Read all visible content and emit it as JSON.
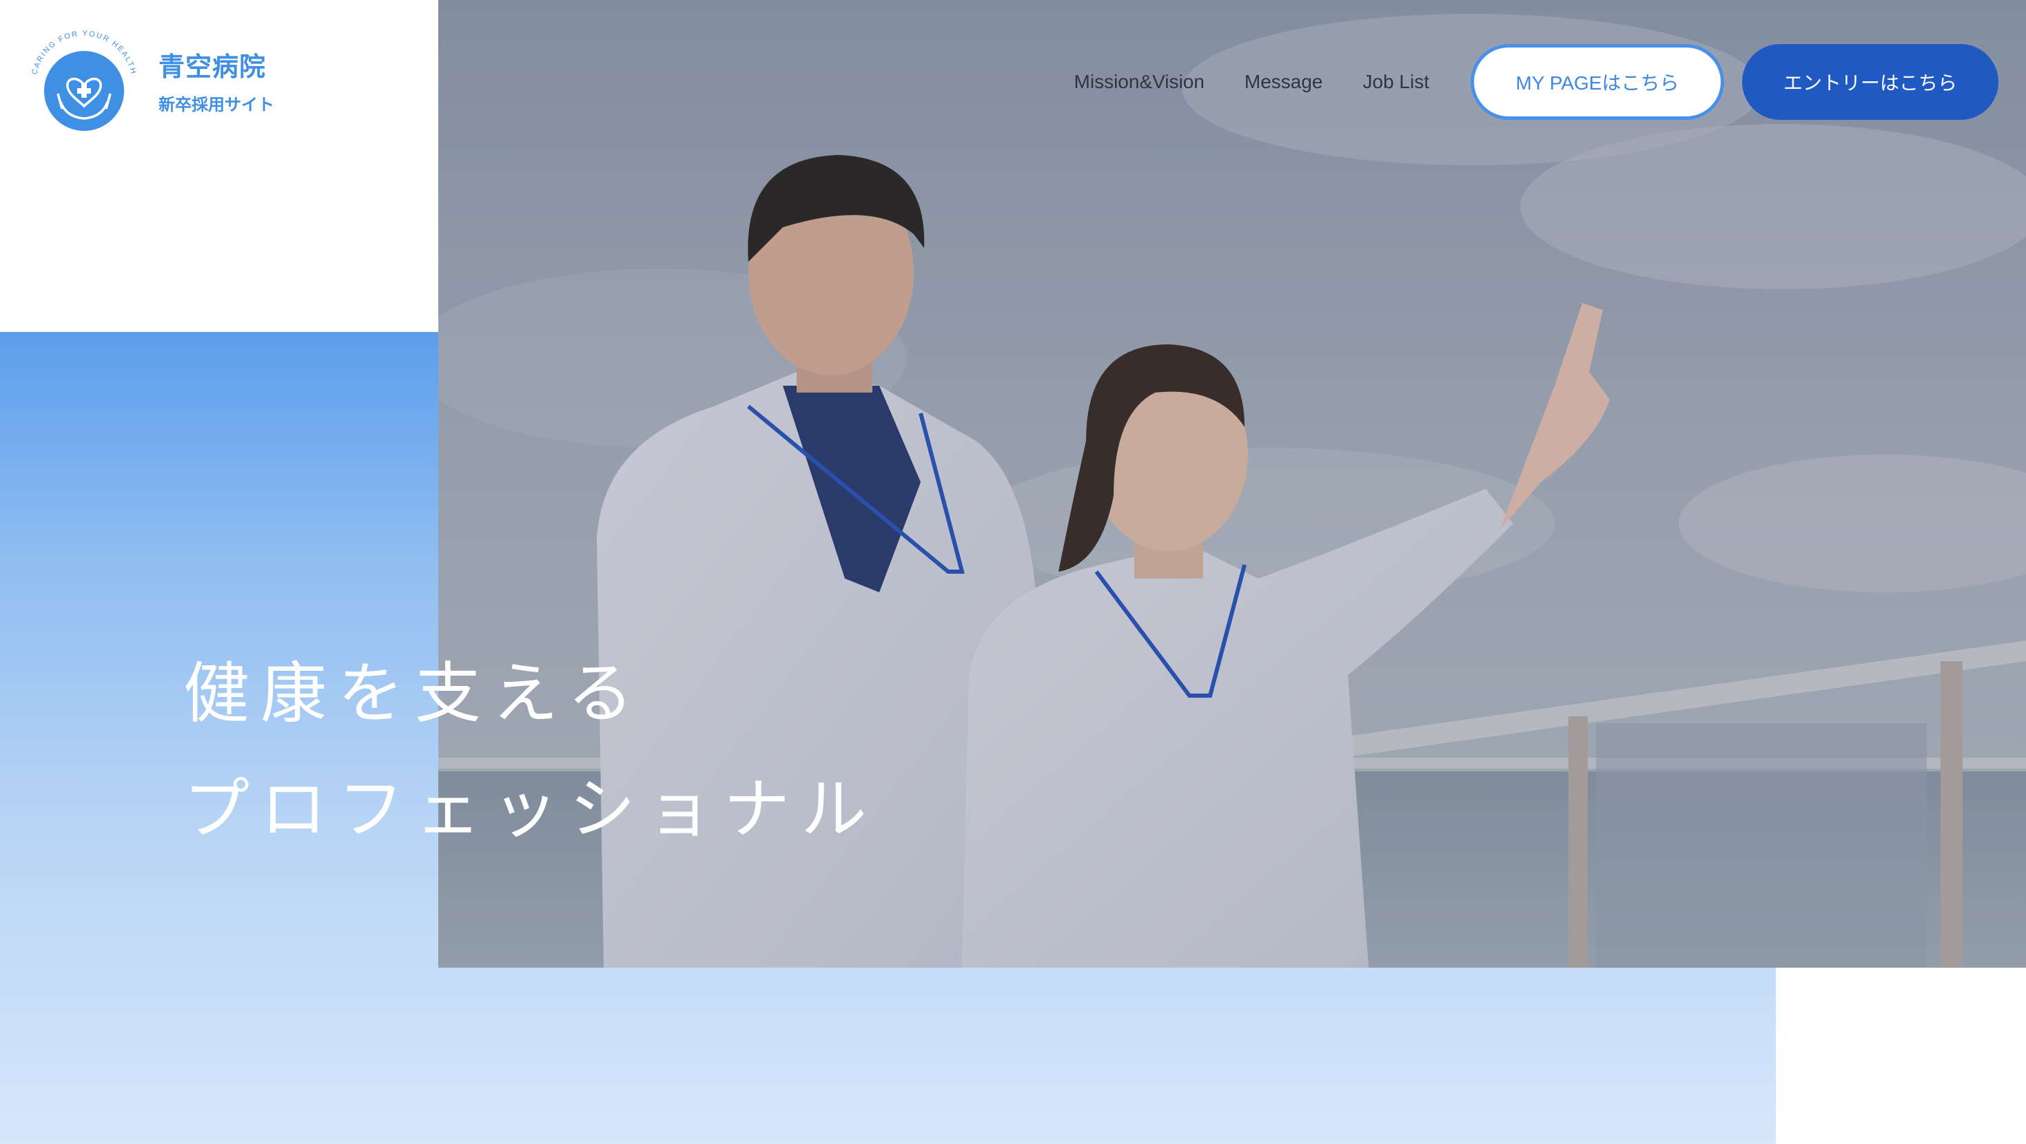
{
  "logo": {
    "title": "青空病院",
    "subtitle": "新卒採用サイト",
    "ring_text": "CARING FOR YOUR HEALTH"
  },
  "nav": {
    "links": [
      "Mission&Vision",
      "Message",
      "Job List"
    ],
    "mypage_label": "MY PAGEはこちら",
    "entry_label": "エントリーはこちら"
  },
  "hero": {
    "headline_line1": "健康を支える",
    "headline_line2": "プロフェッショナル"
  },
  "colors": {
    "brand_blue": "#3f8fe5",
    "entry_button": "#2059c2",
    "text_dark": "#2f3542"
  }
}
